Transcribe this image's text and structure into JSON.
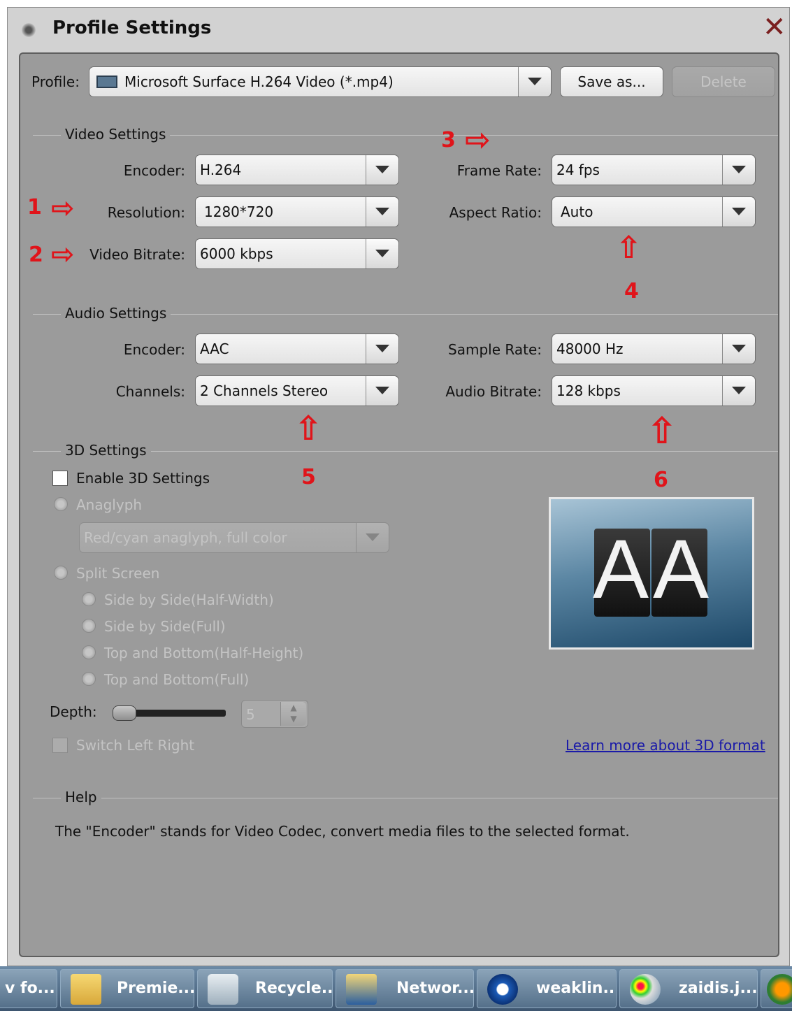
{
  "window": {
    "title": "Profile Settings"
  },
  "profile": {
    "label": "Profile:",
    "value": "Microsoft Surface H.264 Video (*.mp4)",
    "save_as": "Save as...",
    "delete": "Delete"
  },
  "video": {
    "group": "Video Settings",
    "encoder_label": "Encoder:",
    "encoder": "H.264",
    "resolution_label": "Resolution:",
    "resolution": "1280*720",
    "bitrate_label": "Video Bitrate:",
    "bitrate": "6000 kbps",
    "framerate_label": "Frame Rate:",
    "framerate": "24 fps",
    "aspect_label": "Aspect Ratio:",
    "aspect": "Auto"
  },
  "audio": {
    "group": "Audio Settings",
    "encoder_label": "Encoder:",
    "encoder": "AAC",
    "channels_label": "Channels:",
    "channels": "2 Channels Stereo",
    "samplerate_label": "Sample Rate:",
    "samplerate": "48000 Hz",
    "bitrate_label": "Audio Bitrate:",
    "bitrate": "128 kbps"
  },
  "settings3d": {
    "group": "3D Settings",
    "enable": "Enable 3D Settings",
    "anaglyph": "Anaglyph",
    "anaglyph_mode": "Red/cyan anaglyph, full color",
    "split_screen": "Split Screen",
    "split_options": [
      "Side by Side(Half-Width)",
      "Side by Side(Full)",
      "Top and Bottom(Half-Height)",
      "Top and Bottom(Full)"
    ],
    "depth_label": "Depth:",
    "depth_value": "5",
    "switch": "Switch Left Right",
    "learn_more": "Learn more about 3D format",
    "preview_text": "AA"
  },
  "help": {
    "group": "Help",
    "text": "The \"Encoder\" stands for Video Codec, convert media files to the selected format."
  },
  "annotations": [
    "1",
    "2",
    "3",
    "4",
    "5",
    "6"
  ],
  "taskbar": {
    "items": [
      "v fo...",
      "Premie...",
      "Recycle...",
      "Networ...",
      "weaklin...",
      "zaidis.j..."
    ]
  },
  "colors": {
    "panel": "#9b9b9b",
    "annotation_red": "#e0141a",
    "link": "#1a1aa8"
  }
}
